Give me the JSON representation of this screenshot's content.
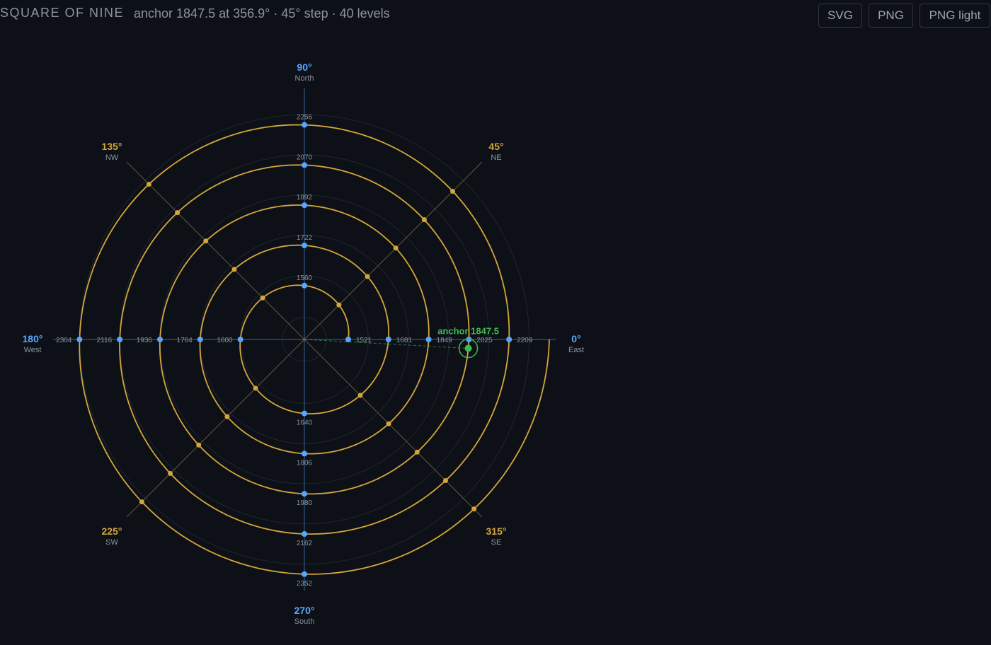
{
  "header": {
    "title": "SQUARE OF NINE",
    "subtitle": "anchor 1847.5 at 356.9° · 45° step · 40 levels"
  },
  "toolbar": {
    "svg_label": "SVG",
    "png_label": "PNG",
    "png_light_label": "PNG light"
  },
  "colors": {
    "background": "#0d1117",
    "ring": "#d4a53c",
    "cardinal": "#58a6ff",
    "anchor": "#3fb950",
    "grid": "#1e2631",
    "text_muted": "#8b949e"
  },
  "chart_data": {
    "type": "polar-spiral",
    "title": "SQUARE OF NINE",
    "anchor": {
      "value": 1847.5,
      "angle": 356.9,
      "label": "anchor 1847.5"
    },
    "step_degrees": 45,
    "levels": 40,
    "rings": 5,
    "directions": [
      {
        "angle": 0,
        "degree_label": "0°",
        "name": "East",
        "kind": "cardinal"
      },
      {
        "angle": 45,
        "degree_label": "45°",
        "name": "NE",
        "kind": "ordinal"
      },
      {
        "angle": 90,
        "degree_label": "90°",
        "name": "North",
        "kind": "cardinal"
      },
      {
        "angle": 135,
        "degree_label": "135°",
        "name": "NW",
        "kind": "ordinal"
      },
      {
        "angle": 180,
        "degree_label": "180°",
        "name": "West",
        "kind": "cardinal"
      },
      {
        "angle": 225,
        "degree_label": "225°",
        "name": "SW",
        "kind": "ordinal"
      },
      {
        "angle": 270,
        "degree_label": "270°",
        "name": "South",
        "kind": "cardinal"
      },
      {
        "angle": 315,
        "degree_label": "315°",
        "name": "SE",
        "kind": "ordinal"
      }
    ],
    "cardinal_values": {
      "0": [
        1521,
        1681,
        1849,
        2025,
        2209
      ],
      "90": [
        1560,
        1722,
        1892,
        2070,
        2256
      ],
      "180": [
        1600,
        1764,
        1936,
        2116,
        2304
      ],
      "270": [
        1640,
        1806,
        1980,
        2162,
        2352
      ]
    }
  }
}
